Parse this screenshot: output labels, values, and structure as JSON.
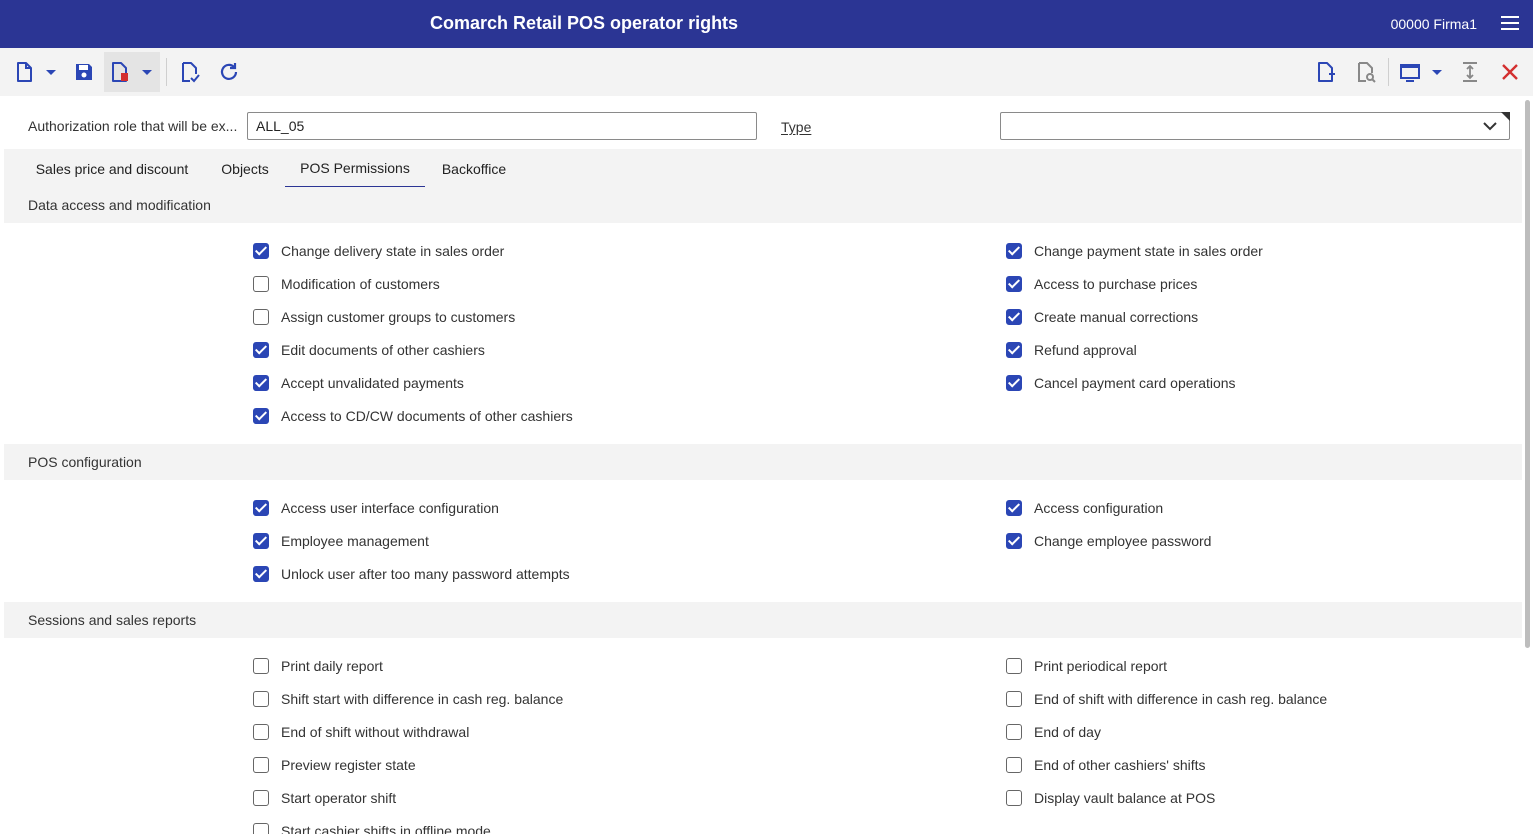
{
  "app": {
    "title": "Comarch Retail POS operator rights",
    "company": "00000  Firma1"
  },
  "form": {
    "role_label": "Authorization role that will be ex...",
    "role_value": "ALL_05",
    "type_label": "Type",
    "type_value": ""
  },
  "tabs": [
    {
      "label": "Sales price and discount"
    },
    {
      "label": "Objects"
    },
    {
      "label": "POS Permissions"
    },
    {
      "label": "Backoffice"
    }
  ],
  "active_tab": "POS Permissions",
  "sections": [
    {
      "title": "Data access and modification",
      "left": [
        {
          "label": "Change delivery state in sales order",
          "checked": true
        },
        {
          "label": "Modification of customers",
          "checked": false
        },
        {
          "label": "Assign customer groups to customers",
          "checked": false
        },
        {
          "label": "Edit documents of other cashiers",
          "checked": true
        },
        {
          "label": "Accept unvalidated payments",
          "checked": true
        },
        {
          "label": "Access to CD/CW documents of other cashiers",
          "checked": true
        }
      ],
      "right": [
        {
          "label": "Change payment state in sales order",
          "checked": true
        },
        {
          "label": "Access to purchase prices",
          "checked": true
        },
        {
          "label": "Create manual corrections",
          "checked": true
        },
        {
          "label": "Refund approval",
          "checked": true
        },
        {
          "label": "Cancel payment card operations",
          "checked": true
        }
      ]
    },
    {
      "title": "POS configuration",
      "left": [
        {
          "label": "Access user interface configuration",
          "checked": true
        },
        {
          "label": "Employee management",
          "checked": true
        },
        {
          "label": "Unlock user after too many password attempts",
          "checked": true
        }
      ],
      "right": [
        {
          "label": "Access configuration",
          "checked": true
        },
        {
          "label": "Change employee password",
          "checked": true
        }
      ]
    },
    {
      "title": "Sessions and sales reports",
      "left": [
        {
          "label": "Print daily report",
          "checked": false
        },
        {
          "label": "Shift start with difference in cash reg. balance",
          "checked": false
        },
        {
          "label": "End of shift without withdrawal",
          "checked": false
        },
        {
          "label": "Preview register state",
          "checked": false
        },
        {
          "label": "Start operator shift",
          "checked": false
        },
        {
          "label": "Start cashier shifts in offline mode",
          "checked": false
        }
      ],
      "right": [
        {
          "label": "Print periodical report",
          "checked": false
        },
        {
          "label": "End of shift with difference in cash reg. balance",
          "checked": false
        },
        {
          "label": "End of day",
          "checked": false
        },
        {
          "label": "End of other cashiers' shifts",
          "checked": false
        },
        {
          "label": "Display vault balance at POS",
          "checked": false
        }
      ]
    }
  ],
  "toolbar": {
    "left_icons": [
      "new-document-icon",
      "save-icon",
      "delete-document-icon",
      "validate-document-icon",
      "refresh-icon"
    ],
    "right_icons": [
      "add-document-icon",
      "preview-document-icon",
      "window-layout-icon",
      "collapse-icon",
      "close-icon"
    ]
  },
  "colors": {
    "header_bg": "#2b3594",
    "accent": "#2b46b5",
    "close": "#d32f2f"
  }
}
